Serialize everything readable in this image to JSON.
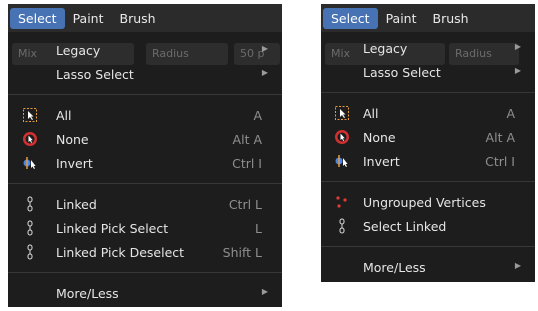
{
  "left": {
    "menubar": [
      "Select",
      "Paint",
      "Brush"
    ],
    "background_hint": {
      "mix": "Mix",
      "radius": "Radius",
      "value": "50 p"
    },
    "items": [
      {
        "label": "Legacy",
        "shortcut": "",
        "has_submenu": true,
        "icon": "none"
      },
      {
        "label": "Lasso Select",
        "shortcut": "",
        "has_submenu": true,
        "icon": "none"
      },
      {
        "label": "All",
        "shortcut": "A",
        "has_submenu": false,
        "icon": "select-all-icon"
      },
      {
        "label": "None",
        "shortcut": "Alt A",
        "has_submenu": false,
        "icon": "select-none-icon"
      },
      {
        "label": "Invert",
        "shortcut": "Ctrl I",
        "has_submenu": false,
        "icon": "select-invert-icon"
      },
      {
        "label": "Linked",
        "shortcut": "Ctrl L",
        "has_submenu": false,
        "icon": "linked-icon"
      },
      {
        "label": "Linked Pick Select",
        "shortcut": "L",
        "has_submenu": false,
        "icon": "linked-icon"
      },
      {
        "label": "Linked Pick Deselect",
        "shortcut": "Shift L",
        "has_submenu": false,
        "icon": "linked-icon"
      },
      {
        "label": "More/Less",
        "shortcut": "",
        "has_submenu": true,
        "icon": "none"
      }
    ]
  },
  "right": {
    "menubar": [
      "Select",
      "Paint",
      "Brush"
    ],
    "background_hint": {
      "mix": "Mix",
      "radius": "Radius"
    },
    "items": [
      {
        "label": "Legacy",
        "shortcut": "",
        "has_submenu": true,
        "icon": "none"
      },
      {
        "label": "Lasso Select",
        "shortcut": "",
        "has_submenu": true,
        "icon": "none"
      },
      {
        "label": "All",
        "shortcut": "A",
        "has_submenu": false,
        "icon": "select-all-icon"
      },
      {
        "label": "None",
        "shortcut": "Alt A",
        "has_submenu": false,
        "icon": "select-none-icon"
      },
      {
        "label": "Invert",
        "shortcut": "Ctrl I",
        "has_submenu": false,
        "icon": "select-invert-icon"
      },
      {
        "label": "Ungrouped Vertices",
        "shortcut": "",
        "has_submenu": false,
        "icon": "ungrouped-vertices-icon"
      },
      {
        "label": "Select Linked",
        "shortcut": "",
        "has_submenu": false,
        "icon": "linked-icon"
      },
      {
        "label": "More/Less",
        "shortcut": "",
        "has_submenu": true,
        "icon": "none"
      }
    ]
  },
  "colors": {
    "accent": "#4772b3",
    "menu_bg": "#1d1d1d",
    "menubar_bg": "#2b2b2b",
    "shortcut": "#8f8f8f"
  }
}
